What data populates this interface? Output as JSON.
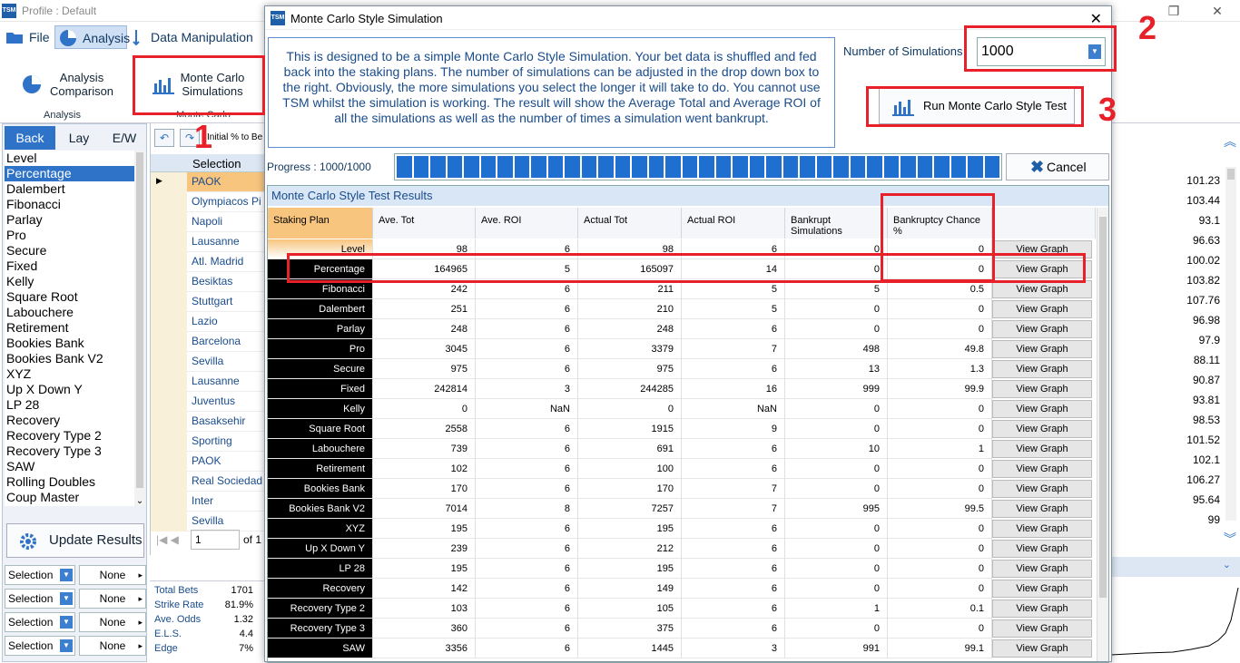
{
  "window": {
    "title": "Profile : Default",
    "logo": "TSM"
  },
  "menu": {
    "file": "File",
    "analysis": "Analysis",
    "data_manipulation": "Data Manipulation"
  },
  "ribbon": {
    "analysis_comparison": "Analysis Comparison",
    "monte_carlo": "Monte Carlo Simulations",
    "group_analysis": "Analysis",
    "group_monte": "Monte Carlo"
  },
  "left": {
    "tabs": [
      "Back",
      "Lay",
      "E/W"
    ],
    "items": [
      "Level",
      "Percentage",
      "Dalembert",
      "Fibonacci",
      "Parlay",
      "Pro",
      "Secure",
      "Fixed",
      "Kelly",
      "Square Root",
      "Labouchere",
      "Retirement",
      "Bookies Bank",
      "Bookies Bank V2",
      "XYZ",
      "Up X Down Y",
      "LP 28",
      "Recovery",
      "Recovery Type 2",
      "Recovery Type 3",
      "SAW",
      "Rolling Doubles",
      "Coup Master"
    ],
    "update_button": "Update Results",
    "selection_label": "Selection",
    "none_label": "None"
  },
  "mid": {
    "toolbar_text": "Initial % to Be",
    "column": "Selection",
    "rows": [
      "PAOK",
      "Olympiacos Pi",
      "Napoli",
      "Lausanne",
      "Atl. Madrid",
      "Besiktas",
      "Stuttgart",
      "Lazio",
      "Barcelona",
      "Sevilla",
      "Lausanne",
      "Juventus",
      "Basaksehir",
      "Sporting",
      "PAOK",
      "Real Sociedad",
      "Inter",
      "Sevilla"
    ],
    "page_value": "1",
    "page_of": "of 1"
  },
  "right_values": [
    "101.23",
    "103.44",
    "93.1",
    "96.63",
    "100.02",
    "103.82",
    "107.76",
    "96.98",
    "97.9",
    "88.11",
    "90.87",
    "93.81",
    "98.53",
    "101.52",
    "102.1",
    "106.27",
    "95.64",
    "99"
  ],
  "stats": [
    {
      "label": "Total Bets",
      "value": "1701"
    },
    {
      "label": "Strike Rate",
      "value": "81.9%"
    },
    {
      "label": "Ave. Odds",
      "value": "1.32"
    },
    {
      "label": "E.L.S.",
      "value": "4.4"
    },
    {
      "label": "Edge",
      "value": "7%"
    }
  ],
  "dialog": {
    "title": "Monte Carlo Style Simulation",
    "logo": "TSM",
    "description": "This is designed to be a simple Monte Carlo Style Simulation. Your bet data is shuffled and fed back into the staking plans. The number of simulations can be adjusted in the drop down box to the right. Obviously, the more simulations you select the longer it will take to do. You cannot use TSM whilst the simulation is working. The result will show the Average Total and Average ROI of all the simulations as well as the number of times a simulation went bankrupt.",
    "num_sim_label": "Number of Simulations",
    "num_sim_value": "1000",
    "run_button": "Run Monte Carlo Style Test",
    "progress_label": "Progress : 1000/1000",
    "progress": 1.0,
    "cancel_button": "Cancel",
    "results_title": "Monte Carlo Style Test Results",
    "columns": [
      "Staking Plan",
      "Ave. Tot",
      "Ave. ROI",
      "Actual Tot",
      "Actual ROI",
      "Bankrupt Simulations",
      "Bankruptcy Chance %"
    ],
    "view_graph": "View Graph",
    "rows": [
      [
        "Level",
        "98",
        "6",
        "98",
        "6",
        "0",
        "0"
      ],
      [
        "Percentage",
        "164965",
        "5",
        "165097",
        "14",
        "0",
        "0"
      ],
      [
        "Fibonacci",
        "242",
        "6",
        "211",
        "5",
        "5",
        "0.5"
      ],
      [
        "Dalembert",
        "251",
        "6",
        "210",
        "5",
        "0",
        "0"
      ],
      [
        "Parlay",
        "248",
        "6",
        "248",
        "6",
        "0",
        "0"
      ],
      [
        "Pro",
        "3045",
        "6",
        "3379",
        "7",
        "498",
        "49.8"
      ],
      [
        "Secure",
        "975",
        "6",
        "975",
        "6",
        "13",
        "1.3"
      ],
      [
        "Fixed",
        "242814",
        "3",
        "244285",
        "16",
        "999",
        "99.9"
      ],
      [
        "Kelly",
        "0",
        "NaN",
        "0",
        "NaN",
        "0",
        "0"
      ],
      [
        "Square Root",
        "2558",
        "6",
        "1915",
        "9",
        "0",
        "0"
      ],
      [
        "Labouchere",
        "739",
        "6",
        "691",
        "6",
        "10",
        "1"
      ],
      [
        "Retirement",
        "102",
        "6",
        "100",
        "6",
        "0",
        "0"
      ],
      [
        "Bookies Bank",
        "170",
        "6",
        "170",
        "7",
        "0",
        "0"
      ],
      [
        "Bookies Bank V2",
        "7014",
        "8",
        "7257",
        "7",
        "995",
        "99.5"
      ],
      [
        "XYZ",
        "195",
        "6",
        "195",
        "6",
        "0",
        "0"
      ],
      [
        "Up X Down Y",
        "239",
        "6",
        "212",
        "6",
        "0",
        "0"
      ],
      [
        "LP 28",
        "195",
        "6",
        "195",
        "6",
        "0",
        "0"
      ],
      [
        "Recovery",
        "142",
        "6",
        "149",
        "6",
        "0",
        "0"
      ],
      [
        "Recovery Type 2",
        "103",
        "6",
        "105",
        "6",
        "1",
        "0.1"
      ],
      [
        "Recovery Type 3",
        "360",
        "6",
        "375",
        "6",
        "0",
        "0"
      ],
      [
        "SAW",
        "3356",
        "6",
        "1445",
        "3",
        "991",
        "99.1"
      ]
    ]
  },
  "annotations": [
    "1",
    "2",
    "3"
  ],
  "colors": {
    "accent": "#2e73c7",
    "annotation": "#e8202a",
    "progress": "#1f6fd0"
  }
}
